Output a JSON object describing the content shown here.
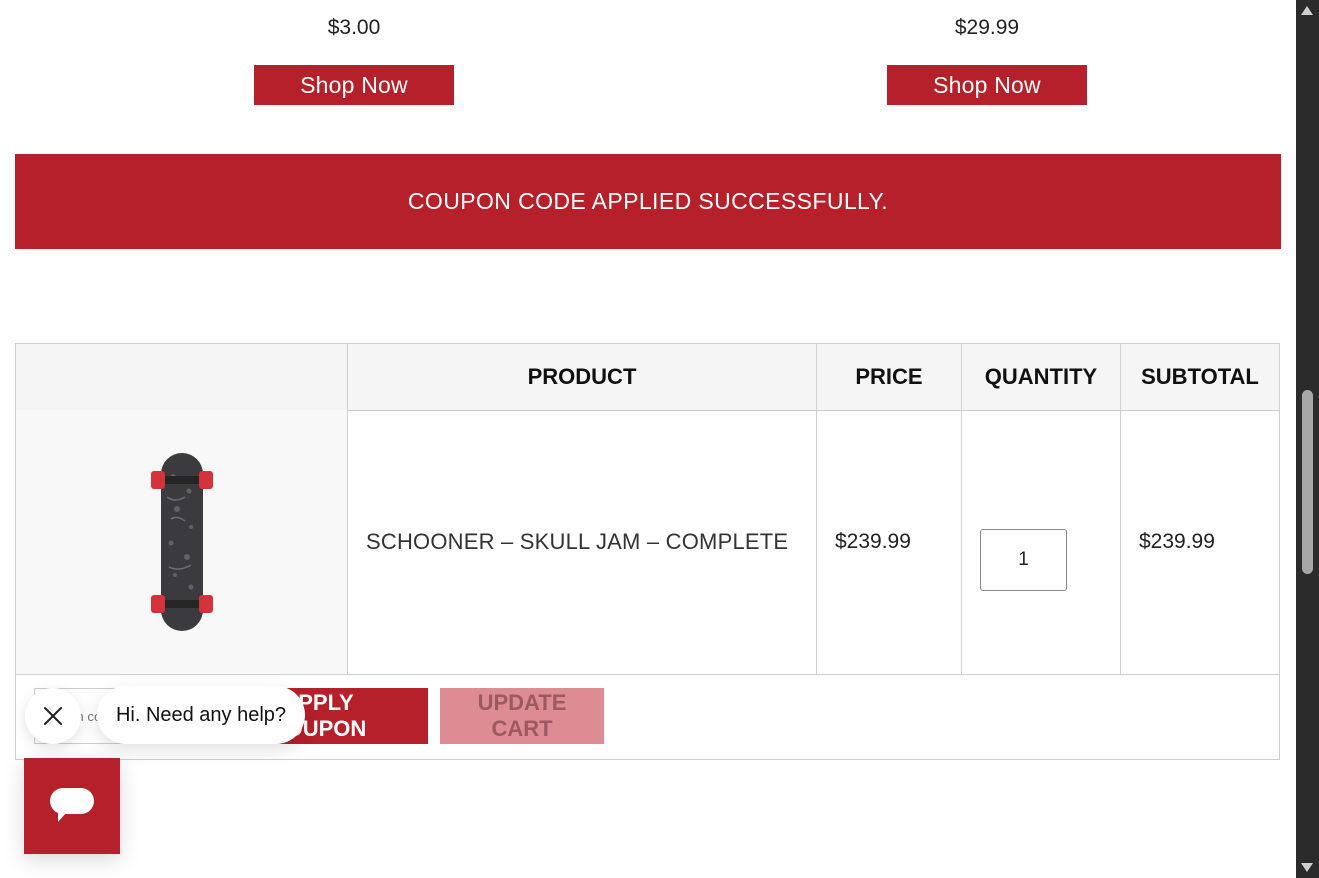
{
  "promos": [
    {
      "price": "$3.00",
      "button": "Shop Now"
    },
    {
      "price": "$29.99",
      "button": "Shop Now"
    }
  ],
  "notice": {
    "message": "COUPON CODE APPLIED SUCCESSFULLY."
  },
  "cart": {
    "headers": {
      "thumbnail": "",
      "product": "PRODUCT",
      "price": "PRICE",
      "quantity": "QUANTITY",
      "subtotal": "SUBTOTAL"
    },
    "items": [
      {
        "name": "SCHOONER – SKULL JAM – COMPLETE",
        "price": "$239.99",
        "quantity": "1",
        "subtotal": "$239.99"
      }
    ],
    "actions": {
      "coupon_placeholder": "Coupon code",
      "apply_label": "APPLY COUPON",
      "update_label": "UPDATE CART"
    }
  },
  "chat": {
    "greeting": "Hi. Need any help?"
  },
  "colors": {
    "brand_red": "#b5202a",
    "disabled_red": "#de8c93"
  }
}
